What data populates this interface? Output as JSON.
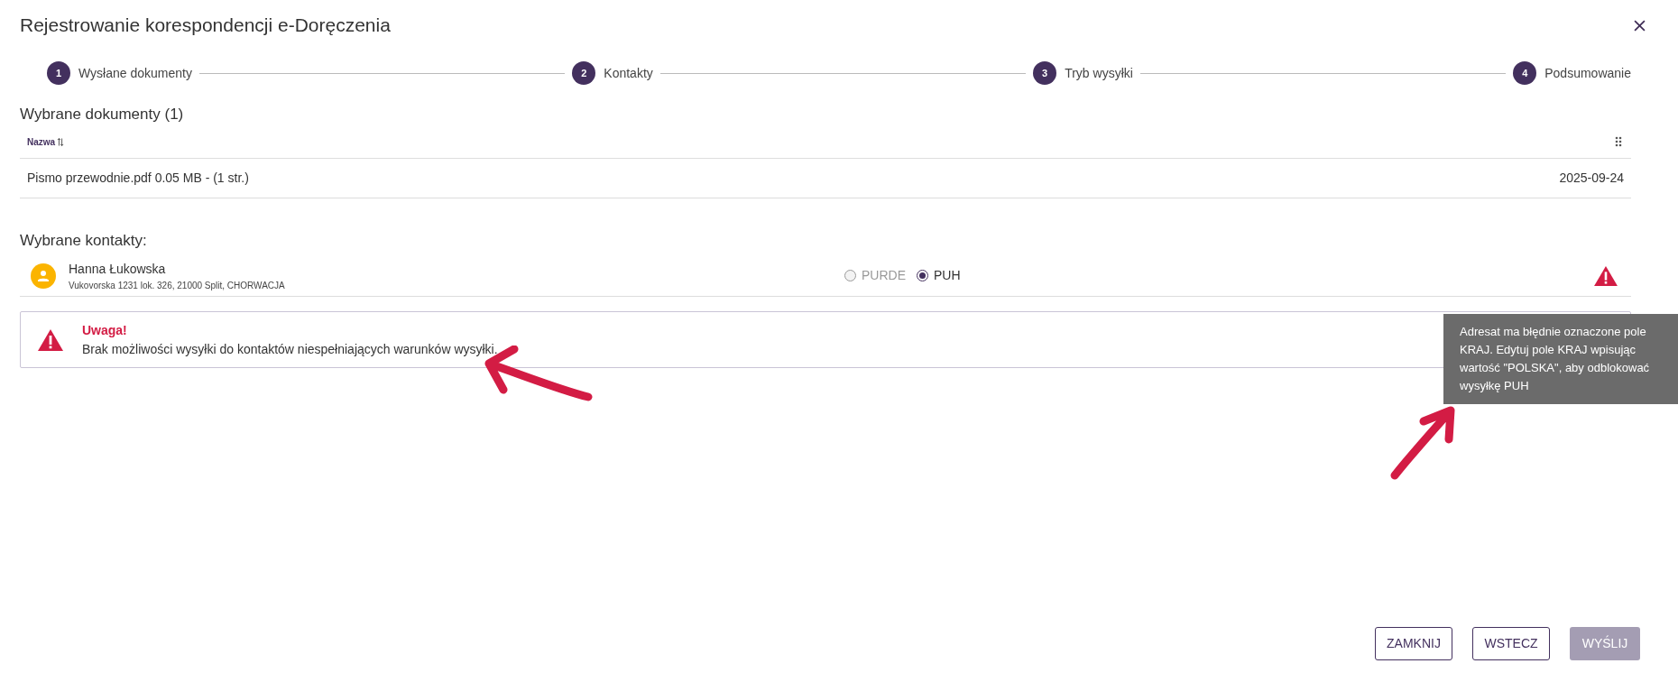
{
  "dialog": {
    "title": "Rejestrowanie korespondencji e-Doręczenia"
  },
  "steps": [
    {
      "number": "1",
      "label": "Wysłane dokumenty"
    },
    {
      "number": "2",
      "label": "Kontakty"
    },
    {
      "number": "3",
      "label": "Tryb wysyłki"
    },
    {
      "number": "4",
      "label": "Podsumowanie"
    }
  ],
  "documents": {
    "heading": "Wybrane dokumenty (1)",
    "columns": [
      "Nazwa"
    ],
    "rows": [
      {
        "name": "Pismo przewodnie.pdf 0.05 MB - (1 str.)",
        "date": "2025-09-24"
      }
    ]
  },
  "contacts": {
    "heading": "Wybrane kontakty:",
    "items": [
      {
        "name": "Hanna Łukowska",
        "address": "Vukovorska 1231 lok. 326, 21000 Split, CHORWACJA",
        "warning": true,
        "options": [
          {
            "label": "PURDE",
            "selected": false,
            "disabled": true
          },
          {
            "label": "PUH",
            "selected": true,
            "disabled": false
          }
        ]
      }
    ]
  },
  "alert": {
    "title": "Uwaga!",
    "message": "Brak możliwości wysyłki do kontaktów niespełniających warunków wysyłki."
  },
  "tooltip": {
    "text": "Adresat ma błędnie oznaczone pole KRAJ. Edytuj pole KRAJ wpisując wartość \"POLSKA\", aby odblokować wysyłkę PUH"
  },
  "buttons": [
    {
      "label": "ZAMKNIJ",
      "disabled": false
    },
    {
      "label": "WSTECZ",
      "disabled": false
    },
    {
      "label": "WYŚLIJ",
      "disabled": true
    }
  ]
}
